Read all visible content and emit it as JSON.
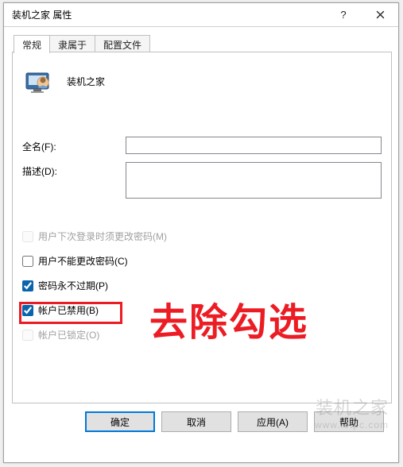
{
  "window": {
    "title": "装机之家 属性"
  },
  "tabs": [
    {
      "label": "常规",
      "active": true
    },
    {
      "label": "隶属于",
      "active": false
    },
    {
      "label": "配置文件",
      "active": false
    }
  ],
  "general": {
    "display_name": "装机之家",
    "fullname_label": "全名(F):",
    "fullname_value": "",
    "description_label": "描述(D):",
    "description_value": ""
  },
  "checkboxes": {
    "must_change": {
      "label": "用户下次登录时须更改密码(M)",
      "checked": false,
      "disabled": true
    },
    "cannot_change": {
      "label": "用户不能更改密码(C)",
      "checked": false,
      "disabled": false
    },
    "never_expires": {
      "label": "密码永不过期(P)",
      "checked": true,
      "disabled": false
    },
    "account_disabled": {
      "label": "帐户已禁用(B)",
      "checked": true,
      "disabled": false
    },
    "account_locked": {
      "label": "帐户已锁定(O)",
      "checked": false,
      "disabled": true
    }
  },
  "buttons": {
    "ok": "确定",
    "cancel": "取消",
    "apply": "应用(A)",
    "help": "帮助"
  },
  "annotation": {
    "text": "去除勾选"
  },
  "watermark": {
    "line1": "装机之家",
    "line2": "www.lotpc.com"
  }
}
